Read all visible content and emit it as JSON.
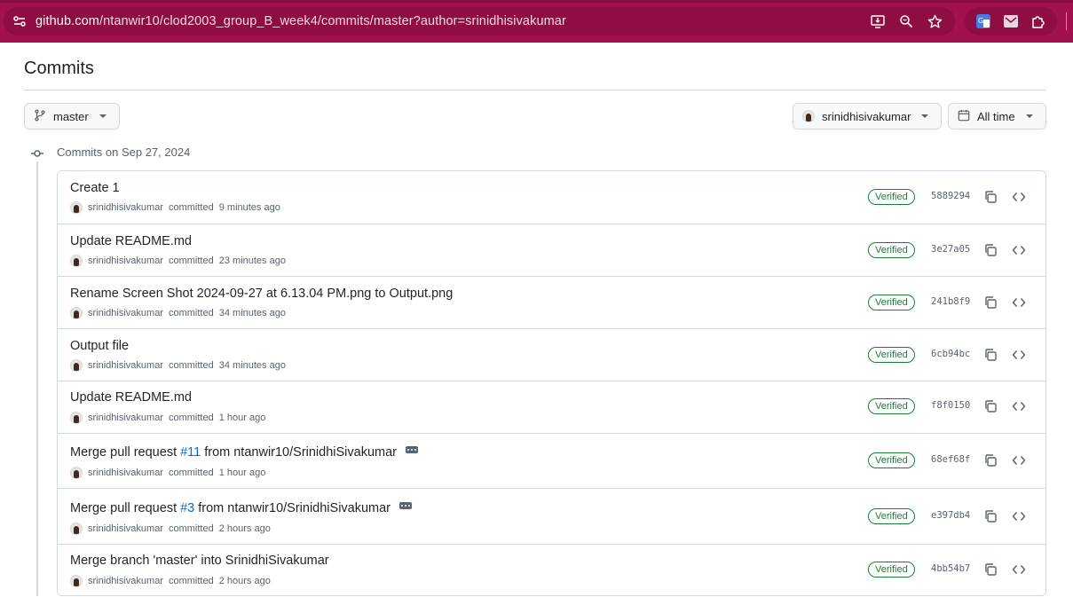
{
  "browser": {
    "url_host": "github.com",
    "url_path": "/ntanwir10/clod2003_group_B_week4/commits/master?author=srinidhisivakumar"
  },
  "page": {
    "title": "Commits",
    "branch": "master",
    "author_filter": "srinidhisivakumar",
    "time_filter": "All time",
    "group_label": "Commits on Sep 27, 2024"
  },
  "commits": [
    {
      "title": "Create 1",
      "author": "srinidhisivakumar",
      "verb": "committed",
      "time": "9 minutes ago",
      "badge": "Verified",
      "sha": "5889294"
    },
    {
      "title": "Update README.md",
      "author": "srinidhisivakumar",
      "verb": "committed",
      "time": "23 minutes ago",
      "badge": "Verified",
      "sha": "3e27a05"
    },
    {
      "title": "Rename Screen Shot 2024-09-27 at 6.13.04 PM.png to Output.png",
      "author": "srinidhisivakumar",
      "verb": "committed",
      "time": "34 minutes ago",
      "badge": "Verified",
      "sha": "241b8f9"
    },
    {
      "title": "Output file",
      "author": "srinidhisivakumar",
      "verb": "committed",
      "time": "34 minutes ago",
      "badge": "Verified",
      "sha": "6cb94bc"
    },
    {
      "title": "Update README.md",
      "author": "srinidhisivakumar",
      "verb": "committed",
      "time": "1 hour ago",
      "badge": "Verified",
      "sha": "f8f0150"
    },
    {
      "title_prefix": "Merge pull request",
      "pr": "#11",
      "title_suffix": "from ntanwir10/SrinidhiSivakumar",
      "author": "srinidhisivakumar",
      "verb": "committed",
      "time": "1 hour ago",
      "badge": "Verified",
      "sha": "68ef68f"
    },
    {
      "title_prefix": "Merge pull request",
      "pr": "#3",
      "title_suffix": "from ntanwir10/SrinidhiSivakumar",
      "author": "srinidhisivakumar",
      "verb": "committed",
      "time": "2 hours ago",
      "badge": "Verified",
      "sha": "e397db4"
    },
    {
      "title": "Merge branch 'master' into SrinidhiSivakumar",
      "author": "srinidhisivakumar",
      "verb": "committed",
      "time": "2 hours ago",
      "badge": "Verified",
      "sha": "4bb54b7"
    }
  ],
  "colors": {
    "chrome_bg": "#a3114d",
    "verified": "#1a7f37",
    "link": "#0969da"
  }
}
